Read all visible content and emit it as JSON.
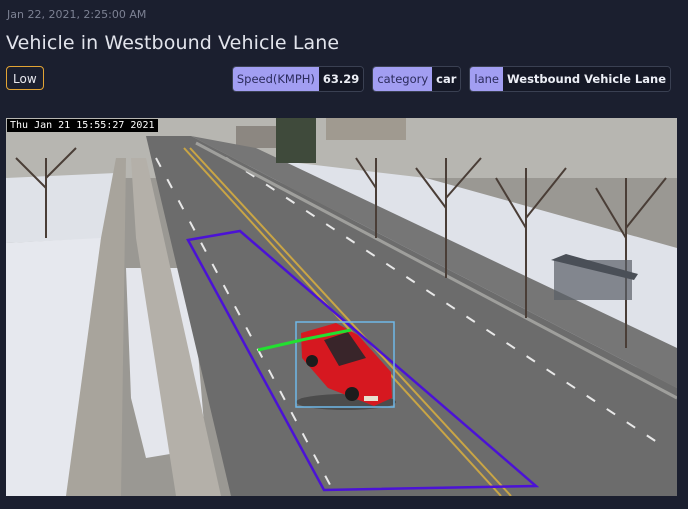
{
  "event": {
    "timestamp": "Jan 22, 2021, 2:25:00 AM",
    "title": "Vehicle in Westbound Vehicle Lane",
    "severity": "Low"
  },
  "tags": [
    {
      "key": "Speed(KMPH)",
      "value": "63.29"
    },
    {
      "key": "category",
      "value": "car"
    },
    {
      "key": "lane",
      "value": "Westbound Vehicle Lane"
    }
  ],
  "camera": {
    "overlay_timestamp": "Thu Jan 21 15:55:27 2021",
    "lane_polygon_color": "#4b12d6",
    "tracking_box_color": "#6fb8e8",
    "trajectory_color": "#22e030",
    "vehicle_color": "#d61820"
  },
  "colors": {
    "background": "#1b1f2f",
    "severity_border": "#e3a434",
    "tag_key_bg": "#a29ef2"
  }
}
